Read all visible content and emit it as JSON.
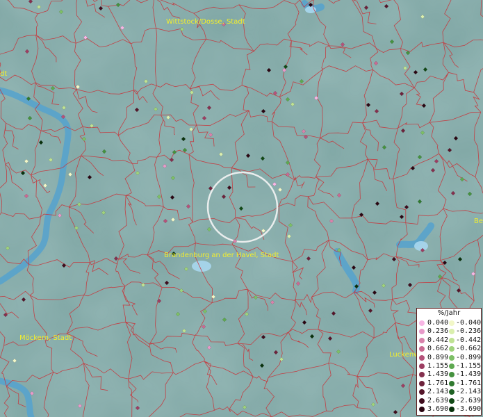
{
  "map": {
    "cities": [
      {
        "name": "Wittstock/Dosse, Stadt"
      },
      {
        "name": "Brandenburg an der Havel, Stadt"
      },
      {
        "name": "Möckern, Stadt"
      },
      {
        "name": "Luckenw"
      },
      {
        "name": "Be"
      },
      {
        "name": "dt"
      }
    ],
    "colors": {
      "background": "#7fa6a4",
      "water": "#58a3cc",
      "border": "#c8343a",
      "label": "#f2ee2e"
    }
  },
  "legend": {
    "title": "%/Jahr",
    "positive": [
      {
        "label": "0.040",
        "color": "#f7b6e4"
      },
      {
        "label": "0.236",
        "color": "#e79ac9"
      },
      {
        "label": "0.442",
        "color": "#d882ab"
      },
      {
        "label": "0.662",
        "color": "#c96a92"
      },
      {
        "label": "0.899",
        "color": "#b5527a"
      },
      {
        "label": "1.155",
        "color": "#9d3e62"
      },
      {
        "label": "1.439",
        "color": "#84304e"
      },
      {
        "label": "1.761",
        "color": "#6d223b"
      },
      {
        "label": "2.143",
        "color": "#55162a"
      },
      {
        "label": "2.639",
        "color": "#3f0c1d"
      },
      {
        "label": "3.690",
        "color": "#2a0612"
      }
    ],
    "negative": [
      {
        "label": "-0.040",
        "color": "#f2f7c8"
      },
      {
        "label": "-0.236",
        "color": "#daefae"
      },
      {
        "label": "-0.442",
        "color": "#bfe293"
      },
      {
        "label": "-0.662",
        "color": "#9fd27c"
      },
      {
        "label": "-0.899",
        "color": "#7dbf66"
      },
      {
        "label": "-1.155",
        "color": "#5ea950"
      },
      {
        "label": "-1.439",
        "color": "#45923f"
      },
      {
        "label": "-1.761",
        "color": "#307a30"
      },
      {
        "label": "-2.143",
        "color": "#1f6224"
      },
      {
        "label": "-2.639",
        "color": "#124a17"
      },
      {
        "label": "-3.690",
        "color": "#08310c"
      }
    ]
  }
}
